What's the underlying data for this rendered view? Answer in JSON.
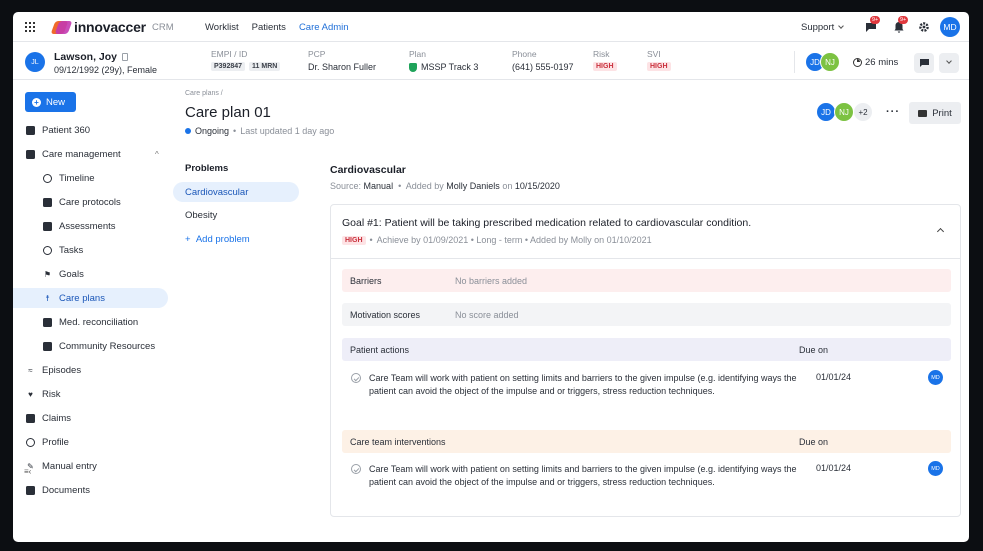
{
  "nav": {
    "brand": "innovaccer",
    "product": "CRM",
    "links": [
      "Worklist",
      "Patients",
      "Care Admin"
    ],
    "active_link": "Care Admin",
    "support_label": "Support",
    "notif_badge_1": "9+",
    "notif_badge_2": "9+",
    "user_initials": "MD"
  },
  "patient": {
    "initials": "JL",
    "name": "Lawson, Joy",
    "dob_line": "09/12/1992 (29y), Female",
    "empi_label": "EMPI / ID",
    "empi_id": "P392847",
    "mrn": "11 MRN",
    "pcp_label": "PCP",
    "pcp": "Dr. Sharon Fuller",
    "plan_label": "Plan",
    "plan": "MSSP Track 3",
    "phone_label": "Phone",
    "phone": "(641) 555-0197",
    "risk_label": "Risk",
    "risk": "HIGH",
    "svi_label": "SVI",
    "svi": "HIGH",
    "team": [
      "JD",
      "NJ"
    ],
    "timer": "26 mins"
  },
  "sidebar": {
    "new_label": "New",
    "items": [
      {
        "label": "Patient 360"
      },
      {
        "label": "Care management"
      },
      {
        "label": "Timeline"
      },
      {
        "label": "Care protocols"
      },
      {
        "label": "Assessments"
      },
      {
        "label": "Tasks"
      },
      {
        "label": "Goals"
      },
      {
        "label": "Care plans"
      },
      {
        "label": "Med. reconciliation"
      },
      {
        "label": "Community Resources"
      },
      {
        "label": "Episodes"
      },
      {
        "label": "Risk"
      },
      {
        "label": "Claims"
      },
      {
        "label": "Profile"
      },
      {
        "label": "Manual entry"
      },
      {
        "label": "Documents"
      }
    ]
  },
  "careplan": {
    "breadcrumb": "Care plans /",
    "title": "Care plan 01",
    "status": "Ongoing",
    "updated": "Last updated 1 day ago",
    "collaborators": [
      "JD",
      "NJ"
    ],
    "more_count": "+2",
    "print_label": "Print"
  },
  "problems": {
    "heading": "Problems",
    "items": [
      "Cardiovascular",
      "Obesity"
    ],
    "add_label": "Add problem"
  },
  "section": {
    "title": "Cardiovascular",
    "source_prefix": "Source:",
    "source": "Manual",
    "added_prefix": "Added by",
    "added_by": "Molly Daniels",
    "on_prefix": "on",
    "added_date": "10/15/2020"
  },
  "goal": {
    "title": "Goal #1: Patient will be taking prescribed medication related to cardiovascular condition.",
    "priority": "HIGH",
    "meta": "Achieve by 01/09/2021 • Long - term • Added by Molly on 01/10/2021",
    "barriers_label": "Barriers",
    "barriers_value": "No barriers added",
    "motivation_label": "Motivation scores",
    "motivation_value": "No score added",
    "patient_actions_label": "Patient actions",
    "due_label": "Due on",
    "patient_actions": [
      {
        "text": "Care Team will work with patient on setting limits and barriers to the given impulse (e.g. identifying ways the patient can avoid the object of the impulse and or triggers, stress reduction techniques.",
        "due": "01/01/24",
        "owner": "MD"
      }
    ],
    "interventions_label": "Care team interventions",
    "interventions": [
      {
        "text": "Care Team will work with patient on setting limits and barriers to the given impulse (e.g. identifying ways the patient can avoid the object of the impulse and or triggers, stress reduction techniques.",
        "due": "01/01/24",
        "owner": "MD"
      }
    ]
  },
  "colors": {
    "primary": "#1a73e8",
    "high_bg": "#fde3e5",
    "high_text": "#c9303c",
    "nj_green": "#7cc242"
  },
  "icons": [
    "grid-icon",
    "chat-icon",
    "bell-icon",
    "gear-icon",
    "clock-icon",
    "chevron-down-icon",
    "printer-icon",
    "more-icon",
    "check-circle-icon"
  ]
}
